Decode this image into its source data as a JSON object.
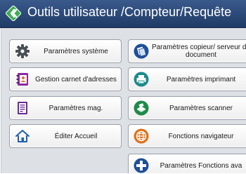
{
  "window": {
    "title": "Outils utilisateur /Compteur/Requête"
  },
  "left_buttons": [
    {
      "label": "Paramètres système",
      "icon": "gear-icon"
    },
    {
      "label": "Gestion carnet d'adresses",
      "icon": "address-book-icon"
    },
    {
      "label": "Paramètres mag.",
      "icon": "tray-document-icon"
    },
    {
      "label": "Éditer Accueil",
      "icon": "home-icon"
    }
  ],
  "right_buttons": [
    {
      "label": "Paramètres copieur/ serveur de document",
      "icon": "copier-icon"
    },
    {
      "label": "Paramètres imprimant",
      "icon": "printer-icon"
    },
    {
      "label": "Paramètres scanner",
      "icon": "scanner-icon"
    },
    {
      "label": "Fonctions navigateur",
      "icon": "browser-globe-icon"
    },
    {
      "label": "Paramètres Fonctions ava",
      "icon": "extended-features-icon"
    }
  ],
  "colors": {
    "title_bar": "#2c4a7c",
    "blue_icon": "#1f4f98",
    "green_icon": "#1e8a4a",
    "orange_icon": "#e0701a",
    "purple_icon": "#6b2c91"
  }
}
